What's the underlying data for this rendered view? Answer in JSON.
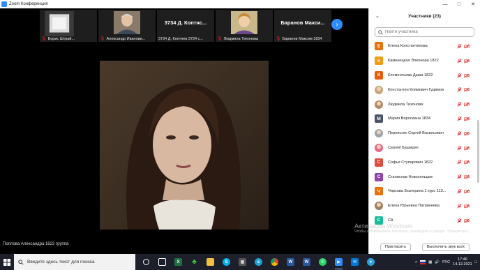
{
  "window": {
    "title": "Zoom Конференция"
  },
  "thumbnails": [
    {
      "label": "Борис Штрай...",
      "big_name": "",
      "muted": true,
      "style": "video"
    },
    {
      "label": "Александр Иванови...",
      "big_name": "",
      "muted": true,
      "style": "photo-man"
    },
    {
      "label": "3734 Д. Коптяев 3734 с...",
      "big_name": "3734 Д. Коптяс...",
      "muted": false,
      "style": "name"
    },
    {
      "label": "Людмила Тихонова",
      "big_name": "",
      "muted": true,
      "style": "photo-woman"
    },
    {
      "label": "Баранов Максим 1834",
      "big_name": "Баранов Макси...",
      "muted": true,
      "style": "name"
    }
  ],
  "speaker": {
    "name": "Поплова Александра 1822 группа"
  },
  "participants_panel": {
    "title": "Участники (23)",
    "search_placeholder": "Найти участника",
    "participants": [
      {
        "name": "Елена Константинова",
        "initial": "Е",
        "color": "#e8710a",
        "photo": false
      },
      {
        "name": "Каменецкая Элеонора 1822",
        "initial": "К",
        "color": "#f39c12",
        "photo": false
      },
      {
        "name": "Клементьева Даша 1822",
        "initial": "К",
        "color": "#e85d0c",
        "photo": false
      },
      {
        "name": "Константин Климович Гудимов",
        "initial": "",
        "color": "#c7a37a",
        "photo": true
      },
      {
        "name": "Людмила Тихонова",
        "initial": "",
        "color": "#b08a6a",
        "photo": true
      },
      {
        "name": "Мария Веросиана 1834",
        "initial": "М",
        "color": "#4a5568",
        "photo": false
      },
      {
        "name": "Перельгин Сергей Васильевич",
        "initial": "",
        "color": "#9aa5b1",
        "photo": true
      },
      {
        "name": "Сергей Баширин",
        "initial": "",
        "color": "#e06a8a",
        "photo": true
      },
      {
        "name": "Софья Ступарович 1822",
        "initial": "С",
        "color": "#e14b3b",
        "photo": false
      },
      {
        "name": "Станислав Новосельцев",
        "initial": "С",
        "color": "#8e44ad",
        "photo": false
      },
      {
        "name": "Чирсова Екатерина 1 курс 113...",
        "initial": "Ч",
        "color": "#e8710a",
        "photo": false
      },
      {
        "name": "Елена Юрьевна Патрикеева",
        "initial": "",
        "color": "#a08060",
        "photo": true
      },
      {
        "name": "СА",
        "initial": "С",
        "color": "#1abc9c",
        "photo": false
      }
    ],
    "invite_label": "Пригласить",
    "mute_all_label": "Выключить звук всех"
  },
  "watermark": {
    "line1": "Активация Windows",
    "line2": "Чтобы активировать Windows, перейдите в раздел \"Параметры\"."
  },
  "taskbar": {
    "search_placeholder": "Введите здесь текст для поиска",
    "lang": "РУС",
    "time": "17:46",
    "date": "14.12.2021"
  }
}
